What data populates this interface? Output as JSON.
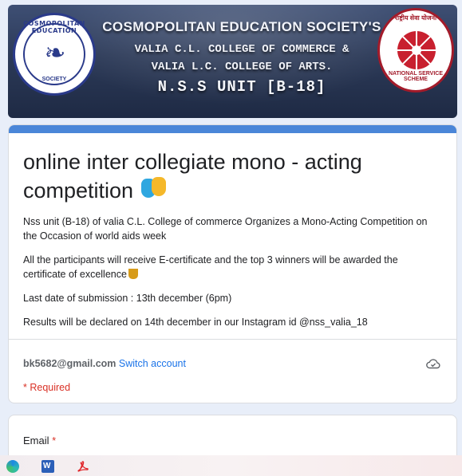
{
  "banner": {
    "title": "COSMOPOLITAN EDUCATION SOCIETY'S",
    "line1": "VALIA C.L. COLLEGE OF COMMERCE &",
    "line2": "VALIA L.C. COLLEGE OF ARTS.",
    "unit": "N.S.S UNIT [B-18]",
    "left_logo": {
      "top_text": "COSMOPOLITAN EDUCATION",
      "bottom_text": "SOCIETY",
      "icon": "swan-icon"
    },
    "right_logo": {
      "top_text": "राष्ट्रीय सेवा योजना",
      "bottom_text": "NATIONAL SERVICE SCHEME",
      "icon": "wheel-icon"
    }
  },
  "form": {
    "title": "online inter collegiate mono - acting competition",
    "title_icon": "theater-masks-icon",
    "description": [
      "Nss unit (B-18) of valia C.L. College of commerce Organizes a Mono-Acting Competition on the Occasion of world aids week",
      "All the participants will receive E-certificate and the top 3 winners will be awarded the certificate of excellence",
      "Last date of submission : 13th december (6pm)",
      "Results will be declared on 14th december in our Instagram id @nss_valia_18"
    ],
    "account_email": "bk5682@gmail.com",
    "switch_account": "Switch account",
    "required_note": "* Required",
    "accent_color": "#4a86d8"
  },
  "question": {
    "label": "Email",
    "required_mark": "*"
  },
  "taskbar": {
    "icons": [
      "edge-icon",
      "word-icon",
      "pdf-icon"
    ],
    "word_glyph": "W"
  }
}
